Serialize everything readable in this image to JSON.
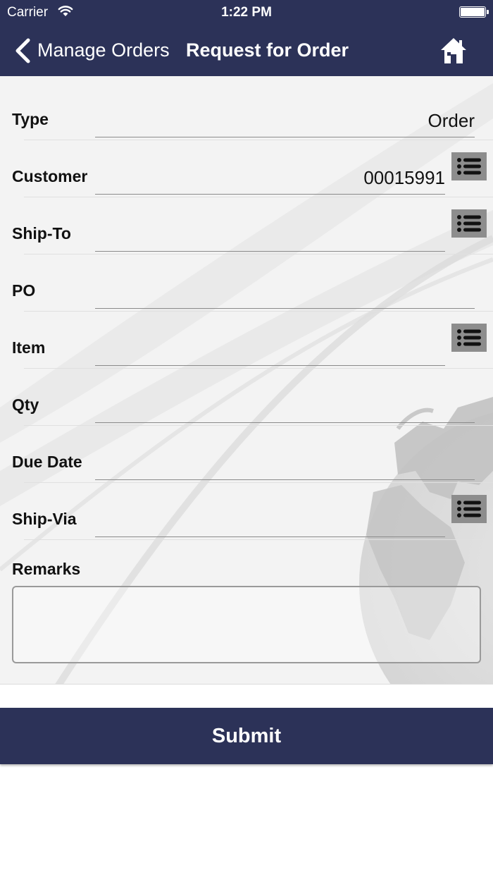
{
  "status_bar": {
    "carrier": "Carrier",
    "time": "1:22 PM"
  },
  "nav": {
    "back_label": "Manage Orders",
    "title": "Request for Order",
    "home_icon": "home-icon"
  },
  "form": {
    "type": {
      "label": "Type",
      "value": "Order"
    },
    "customer": {
      "label": "Customer",
      "value": "00015991"
    },
    "ship_to": {
      "label": "Ship-To",
      "value": ""
    },
    "po": {
      "label": "PO",
      "value": ""
    },
    "item": {
      "label": "Item",
      "value": ""
    },
    "qty": {
      "label": "Qty",
      "value": ""
    },
    "due_date": {
      "label": "Due Date",
      "value": ""
    },
    "ship_via": {
      "label": "Ship-Via",
      "value": ""
    },
    "remarks": {
      "label": "Remarks",
      "value": ""
    }
  },
  "submit_label": "Submit",
  "colors": {
    "nav_bg": "#2c3258",
    "list_button_bg": "#8d8d8d",
    "form_bg": "#f3f3f3"
  }
}
